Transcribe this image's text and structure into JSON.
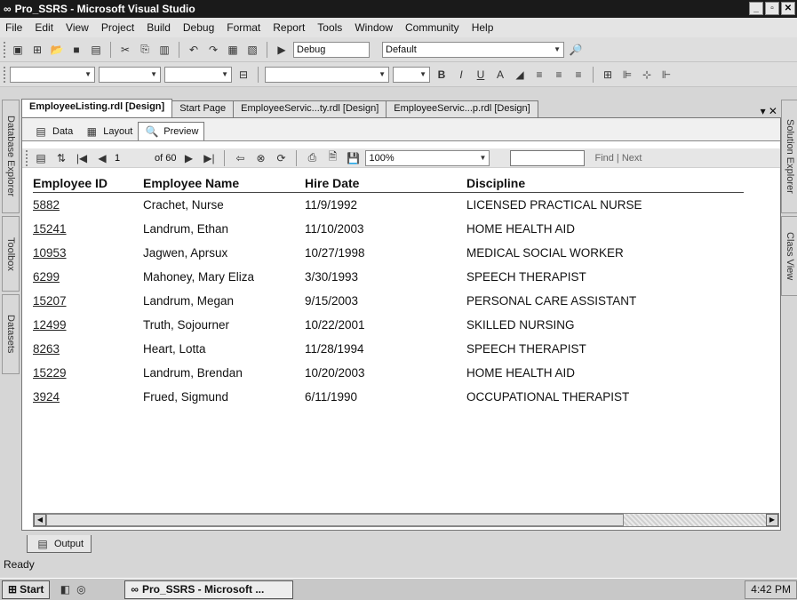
{
  "window": {
    "title": "Pro_SSRS - Microsoft Visual Studio"
  },
  "menu": [
    "File",
    "Edit",
    "View",
    "Project",
    "Build",
    "Debug",
    "Format",
    "Report",
    "Tools",
    "Window",
    "Community",
    "Help"
  ],
  "toolbar": {
    "config": "Debug",
    "platform": "Default"
  },
  "side_left": [
    "Database Explorer",
    "Toolbox",
    "Datasets"
  ],
  "side_right": [
    "Solution Explorer",
    "Class View"
  ],
  "doc_tabs": [
    "EmployeeListing.rdl [Design]",
    "Start Page",
    "EmployeeServic...ty.rdl [Design]",
    "EmployeeServic...p.rdl [Design]"
  ],
  "doc_tab_controls": "▾ ✕",
  "sub_tabs": [
    "Data",
    "Layout",
    "Preview"
  ],
  "report_toolbar": {
    "page": "1",
    "of_pages": "of 60",
    "zoom": "100%",
    "find_next": "Find | Next"
  },
  "table": {
    "headers": [
      "Employee ID",
      "Employee Name",
      "Hire Date",
      "Discipline"
    ],
    "rows": [
      [
        "5882",
        "Crachet, Nurse",
        "11/9/1992",
        "LICENSED PRACTICAL NURSE"
      ],
      [
        "15241",
        "Landrum, Ethan",
        "11/10/2003",
        "HOME HEALTH AID"
      ],
      [
        "10953",
        "Jagwen, Aprsux",
        "10/27/1998",
        "MEDICAL SOCIAL WORKER"
      ],
      [
        "6299",
        "Mahoney, Mary Eliza",
        "3/30/1993",
        "SPEECH THERAPIST"
      ],
      [
        "15207",
        "Landrum, Megan",
        "9/15/2003",
        "PERSONAL CARE ASSISTANT"
      ],
      [
        "12499",
        "Truth, Sojourner",
        "10/22/2001",
        "SKILLED NURSING"
      ],
      [
        "8263",
        "Heart, Lotta",
        "11/28/1994",
        "SPEECH THERAPIST"
      ],
      [
        "15229",
        "Landrum, Brendan",
        "10/20/2003",
        "HOME HEALTH AID"
      ],
      [
        "3924",
        "Frued, Sigmund",
        "6/11/1990",
        "OCCUPATIONAL THERAPIST"
      ]
    ]
  },
  "output_tab": "Output",
  "status": "Ready",
  "taskbar": {
    "start": "Start",
    "item": "Pro_SSRS - Microsoft ...",
    "clock": "4:42 PM"
  }
}
